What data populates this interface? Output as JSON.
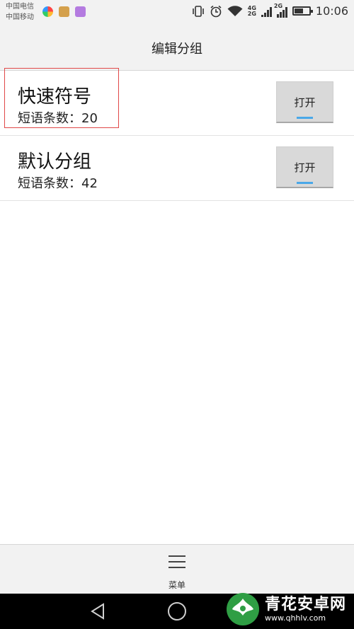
{
  "status_bar": {
    "carrier_1": "中国电信",
    "carrier_2": "中国移动",
    "network_1": "4G",
    "network_2": "2G",
    "network_3": "2G",
    "time": "10:06",
    "battery_level": 0.6
  },
  "header": {
    "title": "编辑分组"
  },
  "groups": [
    {
      "name": "快速符号",
      "count_label": "短语条数：20",
      "button_label": "打开"
    },
    {
      "name": "默认分组",
      "count_label": "短语条数：42",
      "button_label": "打开",
      "highlighted": true
    }
  ],
  "bottom_menu": {
    "label": "菜单",
    "icon": "hamburger-menu-icon"
  },
  "nav": {
    "back": "back-icon",
    "home": "home-icon"
  },
  "watermark": {
    "name": "青花安卓网",
    "url": "www.qhhlv.com"
  },
  "colors": {
    "accent": "#4aa8e8",
    "highlight_border": "#e04848",
    "button_bg": "#d9d9d9"
  }
}
